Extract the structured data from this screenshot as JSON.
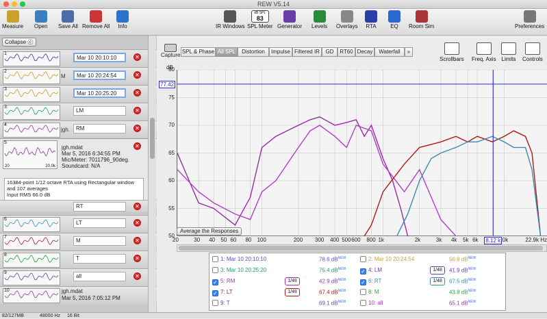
{
  "window": {
    "title": "REW V5.14"
  },
  "toolbar": {
    "items": [
      {
        "label": "Measure",
        "color": "#c9a227"
      },
      {
        "label": "Open",
        "color": "#3a7ec4"
      },
      {
        "label": "Save All",
        "color": "#4a6ea5"
      },
      {
        "label": "Remove All",
        "color": "#c33"
      },
      {
        "label": "Info",
        "color": "#2a74d0"
      },
      {
        "label": "IR Windows",
        "color": "#555"
      },
      {
        "label": "SPL Meter",
        "color": "#444"
      },
      {
        "label": "Generator",
        "color": "#6a3ea8"
      },
      {
        "label": "Levels",
        "color": "#2a8a3a"
      },
      {
        "label": "Overlays",
        "color": "#888"
      },
      {
        "label": "RTA",
        "color": "#2a3fa8"
      },
      {
        "label": "EQ",
        "color": "#2a6ad0"
      },
      {
        "label": "Room Sim",
        "color": "#a33"
      },
      {
        "label": "Preferences",
        "color": "#777"
      }
    ],
    "spl_meter": {
      "unit": "dB SPL",
      "value": "83"
    }
  },
  "left": {
    "collapse_label": "Collapse",
    "rows": [
      {
        "num": "1",
        "label": "Mar 10 20:10:10",
        "side": "",
        "color": "#3030c0"
      },
      {
        "num": "2",
        "label": "Mar 10 20:24:54",
        "side": "M",
        "color": "#d09a2a"
      },
      {
        "num": "3",
        "label": "Mar 10 20:25:20",
        "side": "",
        "color": "#c09a20"
      },
      {
        "num": "3",
        "label": "LM",
        "side": "",
        "color": "#20a060"
      },
      {
        "num": "4",
        "label": "RM",
        "side": "jgh.",
        "color": "#a030b0"
      },
      {
        "num": "6",
        "label": "LT",
        "side": "",
        "color": "#3090c0"
      },
      {
        "num": "7",
        "label": "M",
        "side": "",
        "color": "#b02020"
      },
      {
        "num": "8",
        "label": "T",
        "side": "",
        "color": "#20a030"
      },
      {
        "num": "9",
        "label": "all",
        "side": "",
        "color": "#6040c0"
      },
      {
        "num": "10",
        "label": "jgh.mdat",
        "side": "",
        "color": "#a030b0"
      }
    ],
    "expanded": {
      "num": "5",
      "file": "jgh.mdat",
      "date": "Mar 5, 2016 6:34:55 PM",
      "mic": "Mic/Meter: 7011796_90deg.",
      "soundcard": "Soundcard: N/A",
      "x1": "20",
      "x2": "20.0k",
      "notes": [
        "16384-point 1/12 octave RTA using Rectangular window",
        "and 107 averages",
        "Input RMS 66.0 dB"
      ]
    },
    "rt_label": "RT",
    "row10_date": "Mar 5, 2016 7:05:12 PM"
  },
  "tabs": [
    "SPL & Phase",
    "All SPL",
    "Distortion",
    "Impulse",
    "Filtered IR",
    "GD",
    "RT60",
    "Decay",
    "Waterfall",
    "»"
  ],
  "active_tab": "All SPL",
  "capture_label": "Capture",
  "right_tools": [
    "Scrollbars",
    "Freq. Axis",
    "Limits",
    "Controls"
  ],
  "graph": {
    "y_unit": "dB",
    "marker_value": "77.42",
    "cursor_value": "8.12 k",
    "x_unit": "22.9k Hz",
    "avg_button": "Average the Responses"
  },
  "chart_data": {
    "type": "line",
    "x_scale": "log",
    "xlim": [
      20,
      22900
    ],
    "ylim": [
      50,
      80
    ],
    "y_ticks": [
      "80",
      "75",
      "70",
      "65",
      "60",
      "55",
      "50"
    ],
    "x_ticks": [
      "20",
      "30",
      "40",
      "50",
      "60",
      "80",
      "100",
      "200",
      "300",
      "400",
      "500",
      "600",
      "800",
      "1k",
      "2k",
      "3k",
      "4k",
      "5k",
      "6k",
      "8k",
      "10k"
    ],
    "x_tick_values": [
      20,
      30,
      40,
      50,
      60,
      80,
      100,
      200,
      300,
      400,
      500,
      600,
      800,
      1000,
      2000,
      3000,
      4000,
      5000,
      6000,
      8000,
      10000
    ],
    "series": [
      {
        "name": "5: RM",
        "color": "#9a2aa8",
        "points": [
          [
            20,
            65
          ],
          [
            30,
            56
          ],
          [
            40,
            55
          ],
          [
            60,
            52
          ],
          [
            80,
            57
          ],
          [
            100,
            66
          ],
          [
            130,
            68
          ],
          [
            200,
            70
          ],
          [
            250,
            71
          ],
          [
            300,
            71.5
          ],
          [
            400,
            70
          ],
          [
            500,
            70.5
          ],
          [
            600,
            71
          ],
          [
            700,
            68
          ],
          [
            800,
            70
          ],
          [
            1000,
            64
          ],
          [
            1200,
            60
          ],
          [
            1400,
            55
          ],
          [
            1600,
            50
          ]
        ]
      },
      {
        "name": "9: T",
        "color": "#b040c8",
        "points": [
          [
            20,
            62
          ],
          [
            30,
            58
          ],
          [
            40,
            56
          ],
          [
            60,
            54
          ],
          [
            80,
            53
          ],
          [
            100,
            58
          ],
          [
            130,
            60
          ],
          [
            200,
            66
          ],
          [
            250,
            69
          ],
          [
            300,
            70
          ],
          [
            400,
            68
          ],
          [
            500,
            66
          ],
          [
            600,
            70
          ],
          [
            800,
            69
          ],
          [
            1000,
            63
          ],
          [
            1500,
            58
          ],
          [
            2000,
            62
          ],
          [
            3000,
            53
          ],
          [
            4000,
            50
          ]
        ]
      },
      {
        "name": "7: LT",
        "color": "#b01818",
        "points": [
          [
            700,
            50
          ],
          [
            800,
            52
          ],
          [
            1000,
            58
          ],
          [
            1500,
            63
          ],
          [
            2000,
            66
          ],
          [
            3000,
            67
          ],
          [
            4000,
            68
          ],
          [
            5000,
            67
          ],
          [
            6000,
            68
          ],
          [
            8000,
            67
          ],
          [
            10000,
            68
          ],
          [
            12000,
            69
          ],
          [
            15000,
            68
          ],
          [
            17000,
            65
          ],
          [
            20000,
            50
          ]
        ]
      },
      {
        "name": "6: RT",
        "color": "#3a8ab0",
        "points": [
          [
            1300,
            50
          ],
          [
            1600,
            54
          ],
          [
            2000,
            60
          ],
          [
            2500,
            64
          ],
          [
            3000,
            65
          ],
          [
            4000,
            66
          ],
          [
            5000,
            67
          ],
          [
            6000,
            67
          ],
          [
            8000,
            68
          ],
          [
            10000,
            67
          ],
          [
            12000,
            66
          ],
          [
            15000,
            66
          ],
          [
            17000,
            62
          ],
          [
            20000,
            50
          ]
        ]
      }
    ]
  },
  "legend": [
    {
      "id": "1: Mar 10 20:10:10",
      "value": "78.6 dB",
      "checked": false,
      "color": "#5050d0"
    },
    {
      "id": "2: Mar 10 20:24:54",
      "value": "56.8 dB",
      "checked": false,
      "color": "#c8a040"
    },
    {
      "id": "3: Mar 10 20:25:20",
      "value": "75.4 dB",
      "checked": false,
      "color": "#20a060"
    },
    {
      "id": "4: LM",
      "value": "41.9 dB",
      "checked": true,
      "color": "#6a3ea8",
      "smooth": "1/48"
    },
    {
      "id": "5: RM",
      "value": "42.9 dB",
      "checked": true,
      "color": "#a030b0",
      "smooth": "1/48"
    },
    {
      "id": "6: RT",
      "value": "67.5 dB",
      "checked": true,
      "color": "#3a8ab0",
      "smooth": "1/48"
    },
    {
      "id": "7: LT",
      "value": "67.4 dB",
      "checked": true,
      "color": "#b01818",
      "smooth": "1/48"
    },
    {
      "id": "8: M",
      "value": "43.8 dB",
      "checked": false,
      "color": "#30a040"
    },
    {
      "id": "9: T",
      "value": "69.1 dB",
      "checked": false,
      "color": "#7040c0"
    },
    {
      "id": "10: all",
      "value": "65.1 dB",
      "checked": false,
      "color": "#a030b0"
    }
  ],
  "legend_new": "NEW",
  "status": {
    "memory": "82/127MB",
    "rate": "48000 Hz",
    "bits": "16 Bit"
  }
}
